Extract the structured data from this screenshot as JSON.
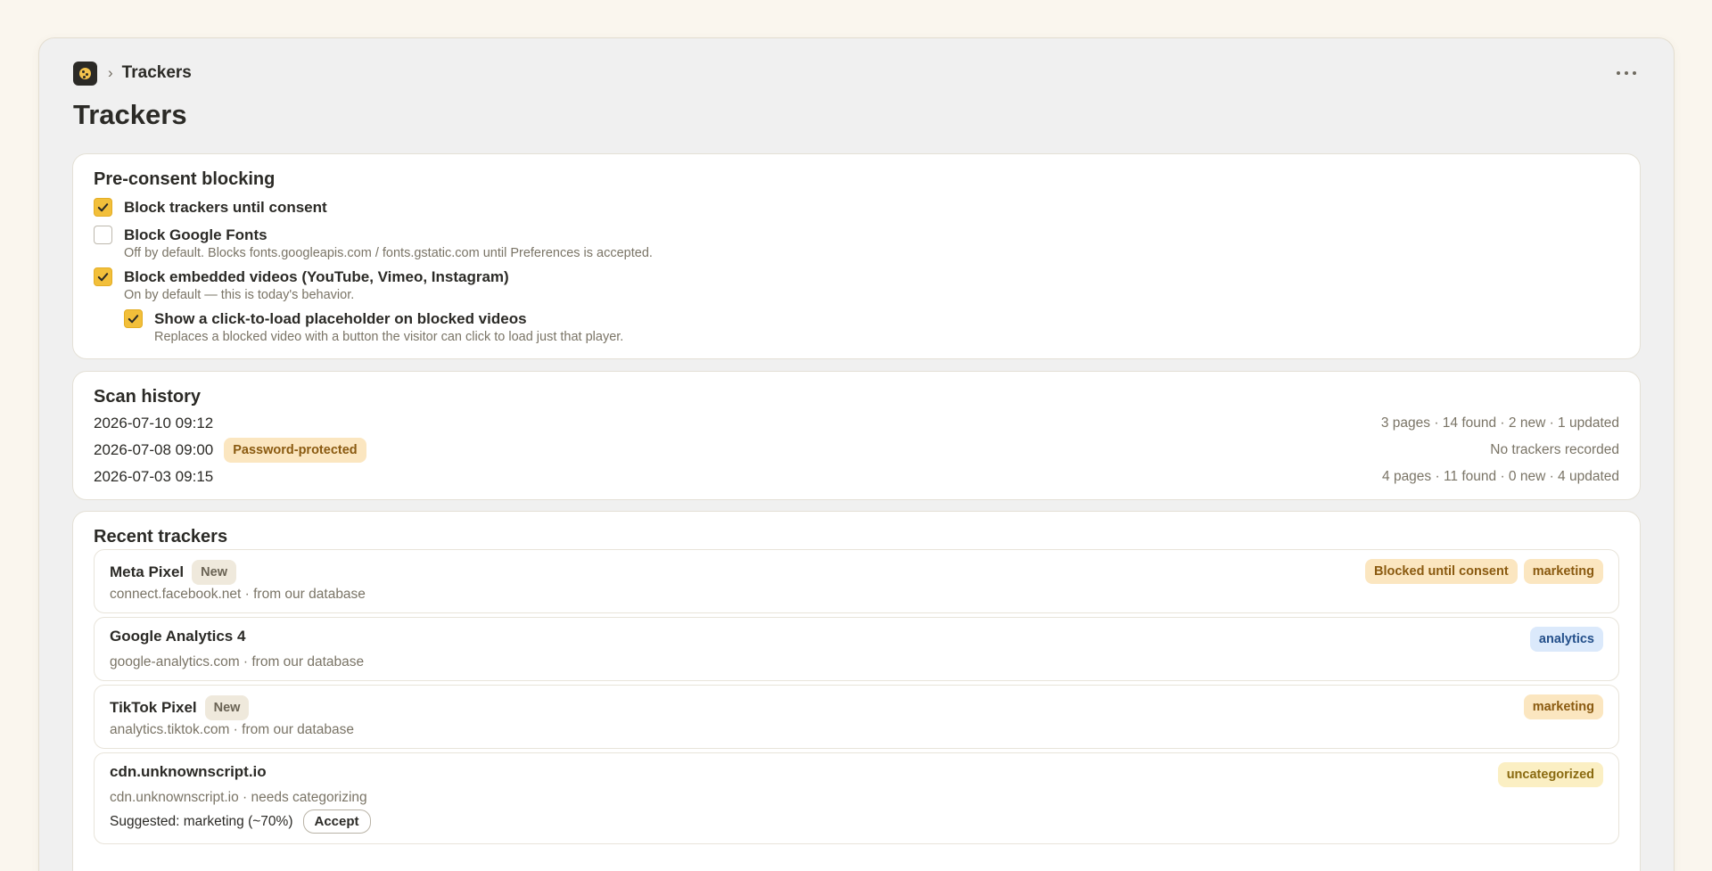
{
  "breadcrumb": {
    "separator": "›",
    "current": "Trackers"
  },
  "page": {
    "title": "Trackers"
  },
  "preconsent": {
    "title": "Pre-consent blocking",
    "options": [
      {
        "label": "Block trackers until consent",
        "desc": "",
        "checked": true
      },
      {
        "label": "Block Google Fonts",
        "desc": "Off by default. Blocks fonts.googleapis.com / fonts.gstatic.com until Preferences is accepted.",
        "checked": false
      },
      {
        "label": "Block embedded videos (YouTube, Vimeo, Instagram)",
        "desc": "On by default — this is today's behavior.",
        "checked": true
      },
      {
        "label": "Show a click-to-load placeholder on blocked videos",
        "desc": "Replaces a blocked video with a button the visitor can click to load just that player.",
        "checked": true
      }
    ]
  },
  "scan_history": {
    "title": "Scan history",
    "rows": [
      {
        "date": "2026-07-10 09:12",
        "badge": "",
        "summary": "3 pages · 14 found · 2 new · 1 updated"
      },
      {
        "date": "2026-07-08 09:00",
        "badge": "Password-protected",
        "summary": "No trackers recorded"
      },
      {
        "date": "2026-07-03 09:15",
        "badge": "",
        "summary": "4 pages · 11 found · 0 new · 4 updated"
      }
    ]
  },
  "recent": {
    "title": "Recent trackers",
    "items": [
      {
        "name": "Meta Pixel",
        "new_badge": "New",
        "sub": "connect.facebook.net · from our database",
        "tags": [
          "Blocked until consent",
          "marketing"
        ]
      },
      {
        "name": "Google Analytics 4",
        "new_badge": "",
        "sub": "google-analytics.com · from our database",
        "tags": [
          "analytics"
        ]
      },
      {
        "name": "TikTok Pixel",
        "new_badge": "New",
        "sub": "analytics.tiktok.com · from our database",
        "tags": [
          "marketing"
        ]
      },
      {
        "name": "cdn.unknownscript.io",
        "new_badge": "",
        "sub": "cdn.unknownscript.io · needs categorizing",
        "tags": [
          "uncategorized"
        ],
        "suggestion": "Suggested: marketing (~70%)",
        "accept_label": "Accept"
      }
    ]
  },
  "colors": {
    "accent": "#f2bf3a",
    "amber_badge": "#fbe6c0",
    "blue_badge": "#dbe9fb",
    "yellow_badge": "#fbefc3"
  }
}
